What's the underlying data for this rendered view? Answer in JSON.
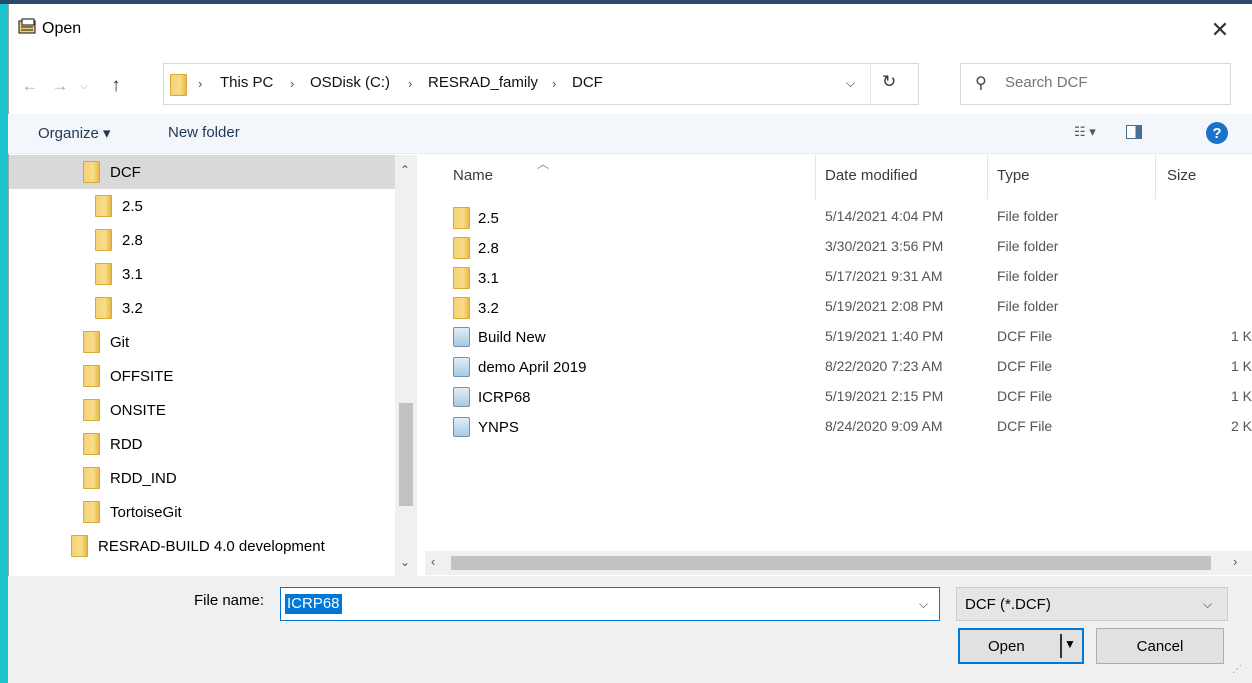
{
  "window": {
    "title": "Open"
  },
  "nav": {
    "breadcrumbs": [
      "This PC",
      "OSDisk (C:)",
      "RESRAD_family",
      "DCF"
    ],
    "search_placeholder": "Search DCF"
  },
  "toolbar": {
    "organize_label": "Organize ▾",
    "new_folder_label": "New folder",
    "help_label": "?"
  },
  "tree": [
    {
      "label": "DCF",
      "selected": true
    },
    {
      "label": "2.5"
    },
    {
      "label": "2.8"
    },
    {
      "label": "3.1"
    },
    {
      "label": "3.2"
    },
    {
      "label": "Git"
    },
    {
      "label": "OFFSITE"
    },
    {
      "label": "ONSITE"
    },
    {
      "label": "RDD"
    },
    {
      "label": "RDD_IND"
    },
    {
      "label": "TortoiseGit"
    },
    {
      "label": "RESRAD-BUILD 4.0 development"
    }
  ],
  "columns": {
    "name": "Name",
    "date": "Date modified",
    "type": "Type",
    "size": "Size"
  },
  "files": [
    {
      "name": "2.5",
      "date": "5/14/2021 4:04 PM",
      "type": "File folder",
      "size": "",
      "icon": "folder-icon"
    },
    {
      "name": "2.8",
      "date": "3/30/2021 3:56 PM",
      "type": "File folder",
      "size": "",
      "icon": "folder-icon"
    },
    {
      "name": "3.1",
      "date": "5/17/2021 9:31 AM",
      "type": "File folder",
      "size": "",
      "icon": "folder-icon"
    },
    {
      "name": "3.2",
      "date": "5/19/2021 2:08 PM",
      "type": "File folder",
      "size": "",
      "icon": "folder-icon"
    },
    {
      "name": "Build New",
      "date": "5/19/2021 1:40 PM",
      "type": "DCF File",
      "size": "1 K",
      "icon": "file-icon"
    },
    {
      "name": "demo April 2019",
      "date": "8/22/2020 7:23 AM",
      "type": "DCF File",
      "size": "1 K",
      "icon": "file-icon"
    },
    {
      "name": "ICRP68",
      "date": "5/19/2021 2:15 PM",
      "type": "DCF File",
      "size": "1 K",
      "icon": "file-icon"
    },
    {
      "name": "YNPS",
      "date": "8/24/2020 9:09 AM",
      "type": "DCF File",
      "size": "2 K",
      "icon": "file-icon"
    }
  ],
  "bottom": {
    "file_name_label": "File name:",
    "file_name_value": "ICRP68",
    "file_type_value": "DCF (*.DCF)",
    "open_label": "Open",
    "cancel_label": "Cancel"
  },
  "colors": {
    "accent": "#0078d7",
    "folder": "#f5d276",
    "selected_row": "#d9d9d9",
    "frame_left": "#1cc4cc"
  }
}
